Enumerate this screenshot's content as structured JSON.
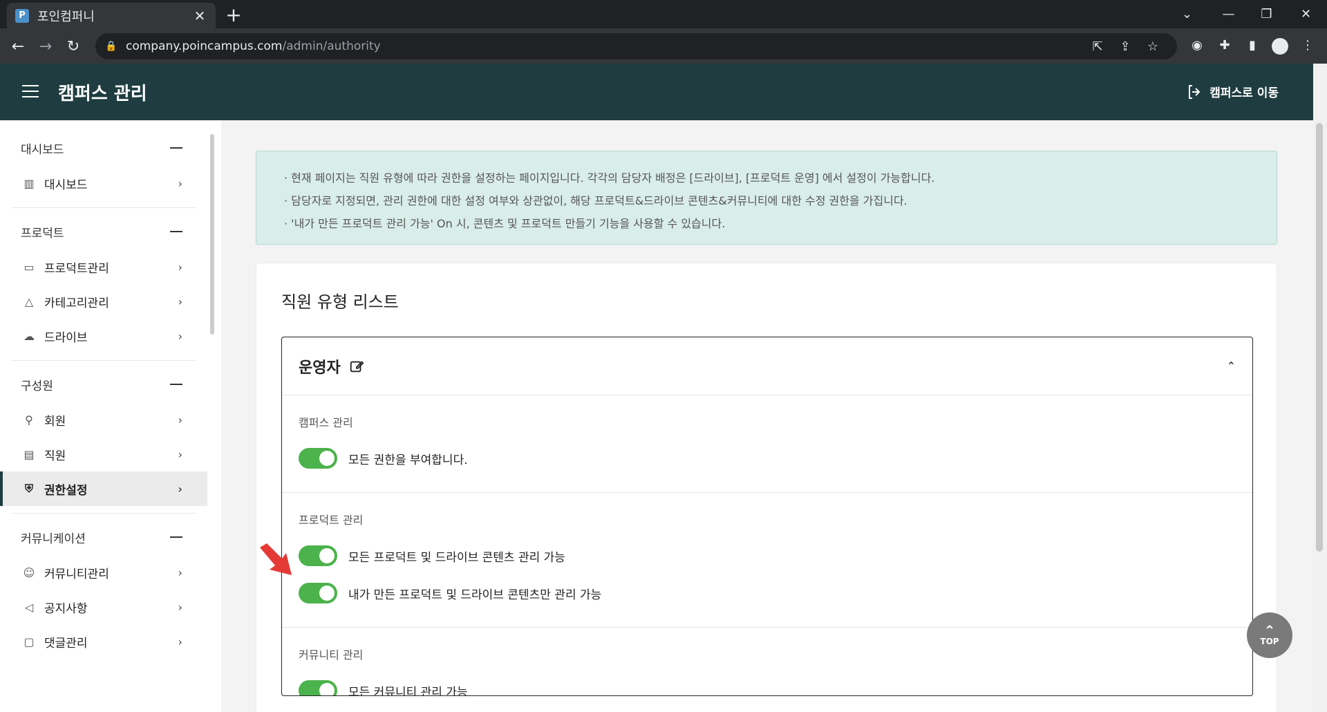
{
  "browser": {
    "tab_title": "포인컴퍼니",
    "tab_favicon": "P",
    "url_host": "company.poincampus.com",
    "url_path": "/admin/authority"
  },
  "header": {
    "title": "캠퍼스 관리",
    "goto_campus": "캠퍼스로 이동"
  },
  "sidebar": {
    "groups": [
      {
        "title": "대시보드",
        "items": [
          {
            "label": "대시보드",
            "icon": "bar-chart-icon"
          }
        ]
      },
      {
        "title": "프로덕트",
        "items": [
          {
            "label": "프로덕트관리",
            "icon": "folder-icon"
          },
          {
            "label": "카테고리관리",
            "icon": "shapes-icon"
          },
          {
            "label": "드라이브",
            "icon": "cloud-icon"
          }
        ]
      },
      {
        "title": "구성원",
        "items": [
          {
            "label": "회원",
            "icon": "user-search-icon"
          },
          {
            "label": "직원",
            "icon": "id-card-icon"
          },
          {
            "label": "권한설정",
            "icon": "shield-user-icon",
            "active": true
          }
        ]
      },
      {
        "title": "커뮤니케이션",
        "items": [
          {
            "label": "커뮤니티관리",
            "icon": "group-icon"
          },
          {
            "label": "공지사항",
            "icon": "megaphone-icon"
          },
          {
            "label": "댓글관리",
            "icon": "comment-icon"
          }
        ]
      }
    ]
  },
  "notice": {
    "lines": [
      "· 현재 페이지는 직원 유형에 따라 권한을 설정하는 페이지입니다. 각각의 담당자 배정은 [드라이브], [프로덕트 운영] 에서 설정이 가능합니다.",
      "· 담당자로 지정되면, 관리 권한에 대한 설정 여부와 상관없이, 해당 프로덕트&드라이브 콘텐츠&커뮤니티에 대한 수정 권한을 가집니다.",
      "· '내가 만든 프로덕트 관리 가능' On 시, 콘텐츠 및 프로덕트 만들기 기능을 사용할 수 있습니다."
    ]
  },
  "card": {
    "title": "직원 유형 리스트",
    "role": {
      "name": "운영자",
      "sections": [
        {
          "title": "캠퍼스 관리",
          "perms": [
            {
              "label": "모든 권한을 부여합니다.",
              "on": true
            }
          ]
        },
        {
          "title": "프로덕트 관리",
          "perms": [
            {
              "label": "모든 프로덕트 및 드라이브 콘텐츠 관리 가능",
              "on": true
            },
            {
              "label": "내가 만든 프로덕트 및 드라이브 콘텐츠만 관리 가능",
              "on": true
            }
          ]
        },
        {
          "title": "커뮤니티 관리",
          "perms": [
            {
              "label": "모든 커뮤니티 관리 가능",
              "on": true
            }
          ]
        }
      ]
    }
  },
  "top_button": "TOP",
  "colors": {
    "header_bg": "#1f3d40",
    "toggle_on": "#4cb24c",
    "notice_bg": "#d9ede9",
    "arrow": "#e53935"
  }
}
